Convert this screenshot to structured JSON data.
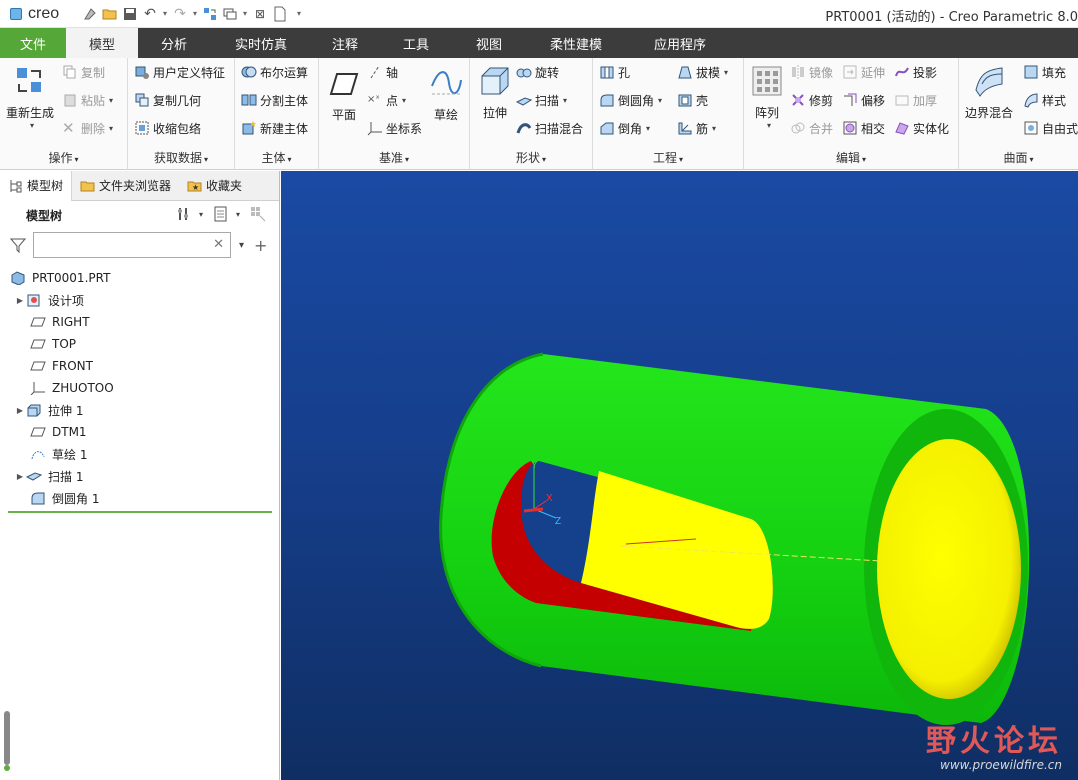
{
  "app": {
    "logo_text": "creo",
    "window_title": "PRT0001 (活动的) - Creo Parametric 8.0"
  },
  "menu": {
    "tabs": [
      {
        "label": "文件"
      },
      {
        "label": "模型"
      },
      {
        "label": "分析"
      },
      {
        "label": "实时仿真"
      },
      {
        "label": "注释"
      },
      {
        "label": "工具"
      },
      {
        "label": "视图"
      },
      {
        "label": "柔性建模"
      },
      {
        "label": "应用程序"
      }
    ],
    "active": "模型"
  },
  "ribbon": {
    "operations": {
      "group": "操作",
      "regen": "重新生成",
      "copy": "复制",
      "paste": "粘贴",
      "delete": "删除"
    },
    "get_data": {
      "group": "获取数据",
      "udf": "用户定义特征",
      "copy_geom": "复制几何",
      "shrinkwrap": "收缩包络"
    },
    "body": {
      "group": "主体",
      "boolean": "布尔运算",
      "split": "分割主体",
      "new_body": "新建主体"
    },
    "datum": {
      "group": "基准",
      "plane": "平面",
      "axis": "轴",
      "point": "点",
      "csys": "坐标系",
      "sketch": "草绘"
    },
    "shapes": {
      "group": "形状",
      "extrude": "拉伸",
      "revolve": "旋转",
      "sweep": "扫描",
      "swept_blend": "扫描混合"
    },
    "engineering": {
      "group": "工程",
      "hole": "孔",
      "round": "倒圆角",
      "chamfer": "倒角",
      "draft": "拔模",
      "shell": "壳",
      "rib": "筋"
    },
    "editing": {
      "group": "编辑",
      "pattern": "阵列",
      "mirror": "镜像",
      "trim": "修剪",
      "merge": "合并",
      "extend": "延伸",
      "offset": "偏移",
      "intersect": "相交",
      "project": "投影",
      "thicken": "加厚",
      "solidify": "实体化"
    },
    "surfaces": {
      "group": "曲面",
      "boundary_blend": "边界混合",
      "fill": "填充",
      "style": "样式",
      "freestyle": "自由式"
    }
  },
  "panel": {
    "tabs": [
      {
        "label": "模型树"
      },
      {
        "label": "文件夹浏览器"
      },
      {
        "label": "收藏夹"
      }
    ],
    "tree_title": "模型树",
    "search_value": "",
    "tree": [
      {
        "label": "PRT0001.PRT"
      },
      {
        "label": "设计项"
      },
      {
        "label": "RIGHT"
      },
      {
        "label": "TOP"
      },
      {
        "label": "FRONT"
      },
      {
        "label": "ZHUOTOO"
      },
      {
        "label": "拉伸 1"
      },
      {
        "label": "DTM1"
      },
      {
        "label": "草绘 1"
      },
      {
        "label": "扫描 1"
      },
      {
        "label": "倒圆角 1"
      }
    ]
  },
  "viewport": {
    "colors": {
      "body": "#18e018",
      "slot": "#ffff00",
      "inner": "#c00000",
      "background": "#174596"
    },
    "axis_labels": {
      "x": "X",
      "y": "Y",
      "z": "Z"
    }
  },
  "watermark": {
    "title": "野火论坛",
    "url": "www.proewildfire.cn"
  }
}
